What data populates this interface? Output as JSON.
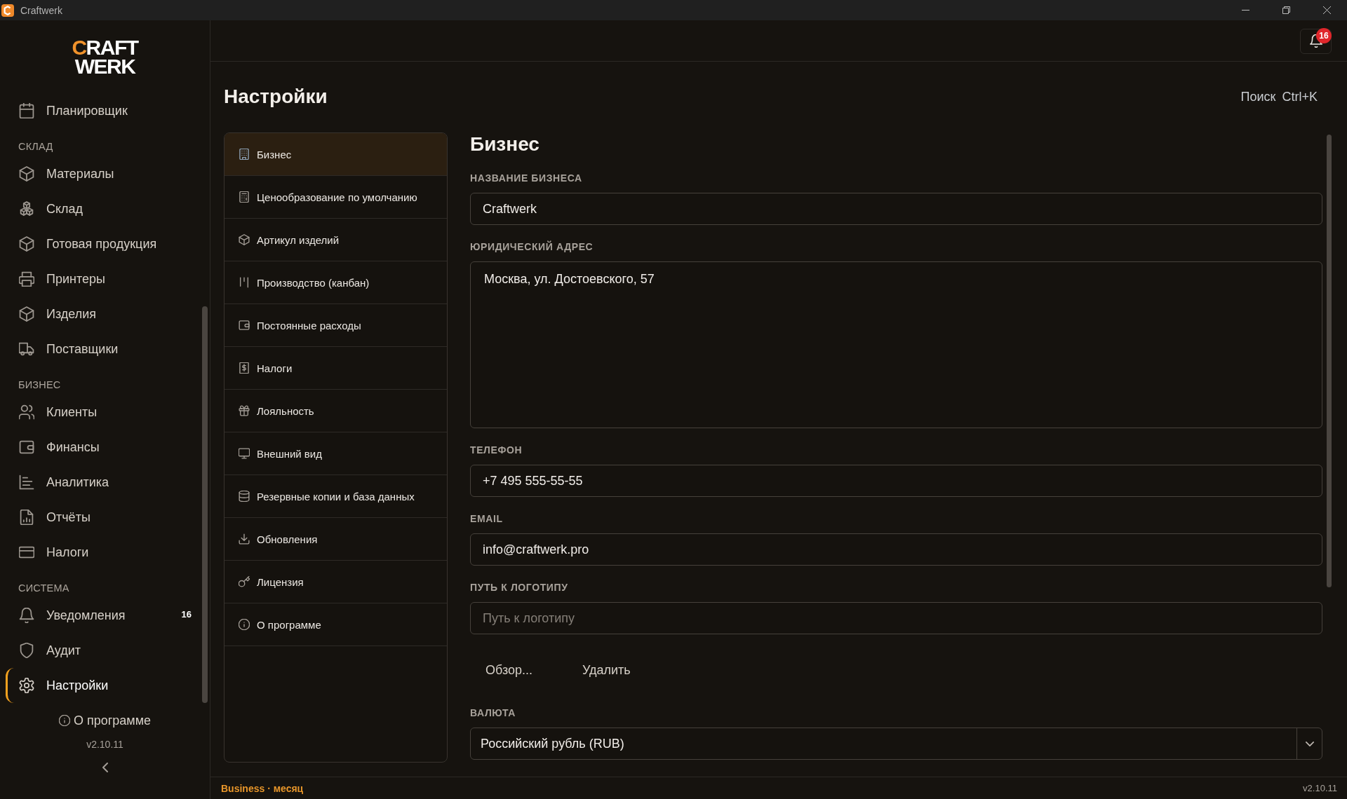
{
  "window": {
    "title": "Craftwerk"
  },
  "sidebar": {
    "logo": {
      "mark": "C",
      "rest": "RAFT",
      "line_2": "WERK"
    },
    "sections": [
      {
        "items": [
          {
            "label": "Планировщик",
            "selected": false
          }
        ]
      },
      {
        "heading": "СКЛАД",
        "items": [
          {
            "label": "Материалы",
            "selected": false
          },
          {
            "label": "Склад",
            "selected": false
          },
          {
            "label": "Готовая продукция",
            "selected": false
          },
          {
            "label": "Принтеры",
            "selected": false
          },
          {
            "label": "Изделия",
            "selected": false
          },
          {
            "label": "Поставщики",
            "selected": false
          }
        ]
      },
      {
        "heading": "БИЗНЕС",
        "items": [
          {
            "label": "Клиенты",
            "selected": false
          },
          {
            "label": "Финансы",
            "selected": false
          },
          {
            "label": "Аналитика",
            "selected": false
          },
          {
            "label": "Отчёты",
            "selected": false
          },
          {
            "label": "Налоги",
            "selected": false
          }
        ]
      },
      {
        "heading": "СИСТЕМА",
        "items": [
          {
            "label": "Уведомления",
            "selected": false,
            "badge": "16"
          },
          {
            "label": "Аудит",
            "selected": false
          },
          {
            "label": "Настройки",
            "selected": true
          }
        ]
      }
    ],
    "about": "О программе",
    "version": "v2.10.11"
  },
  "top_bar": {
    "notifications_badge": "16"
  },
  "page": {
    "title": "Настройки",
    "search": {
      "label": "Поиск",
      "shortcut": "Ctrl+K"
    }
  },
  "settings_nav": {
    "items": [
      {
        "label": "Бизнес",
        "selected": true
      },
      {
        "label": "Ценообразование по умолчанию",
        "selected": false
      },
      {
        "label": "Артикул изделий",
        "selected": false
      },
      {
        "label": "Производство (канбан)",
        "selected": false
      },
      {
        "label": "Постоянные расходы",
        "selected": false
      },
      {
        "label": "Налоги",
        "selected": false
      },
      {
        "label": "Лояльность",
        "selected": false
      },
      {
        "label": "Внешний вид",
        "selected": false
      },
      {
        "label": "Резервные копии и база данных",
        "selected": false
      },
      {
        "label": "Обновления",
        "selected": false
      },
      {
        "label": "Лицензия",
        "selected": false
      },
      {
        "label": "О программе",
        "selected": false
      }
    ]
  },
  "form": {
    "heading": "Бизнес",
    "fields": [
      {
        "kind": "input",
        "label": "НАЗВАНИЕ БИЗНЕСА",
        "value": "Craftwerk"
      },
      {
        "kind": "textarea",
        "label": "ЮРИДИЧЕСКИЙ АДРЕС",
        "value": "Москва, ул. Достоевского, 57"
      },
      {
        "kind": "input",
        "label": "ТЕЛЕФОН",
        "value": "+7 495 555-55-55"
      },
      {
        "kind": "input",
        "label": "EMAIL",
        "value": "info@craftwerk.pro"
      },
      {
        "kind": "input",
        "label": "ПУТЬ К ЛОГОТИПУ",
        "placeholder": "Путь к логотипу"
      },
      {
        "kind": "buttons",
        "buttons": [
          "Обзор...",
          "Удалить"
        ]
      },
      {
        "kind": "select",
        "label": "ВАЛЮТА",
        "value": "Российский рубль (RUB)"
      }
    ]
  },
  "status_bar": {
    "plan": "Business · месяц",
    "version": "v2.10.11"
  }
}
